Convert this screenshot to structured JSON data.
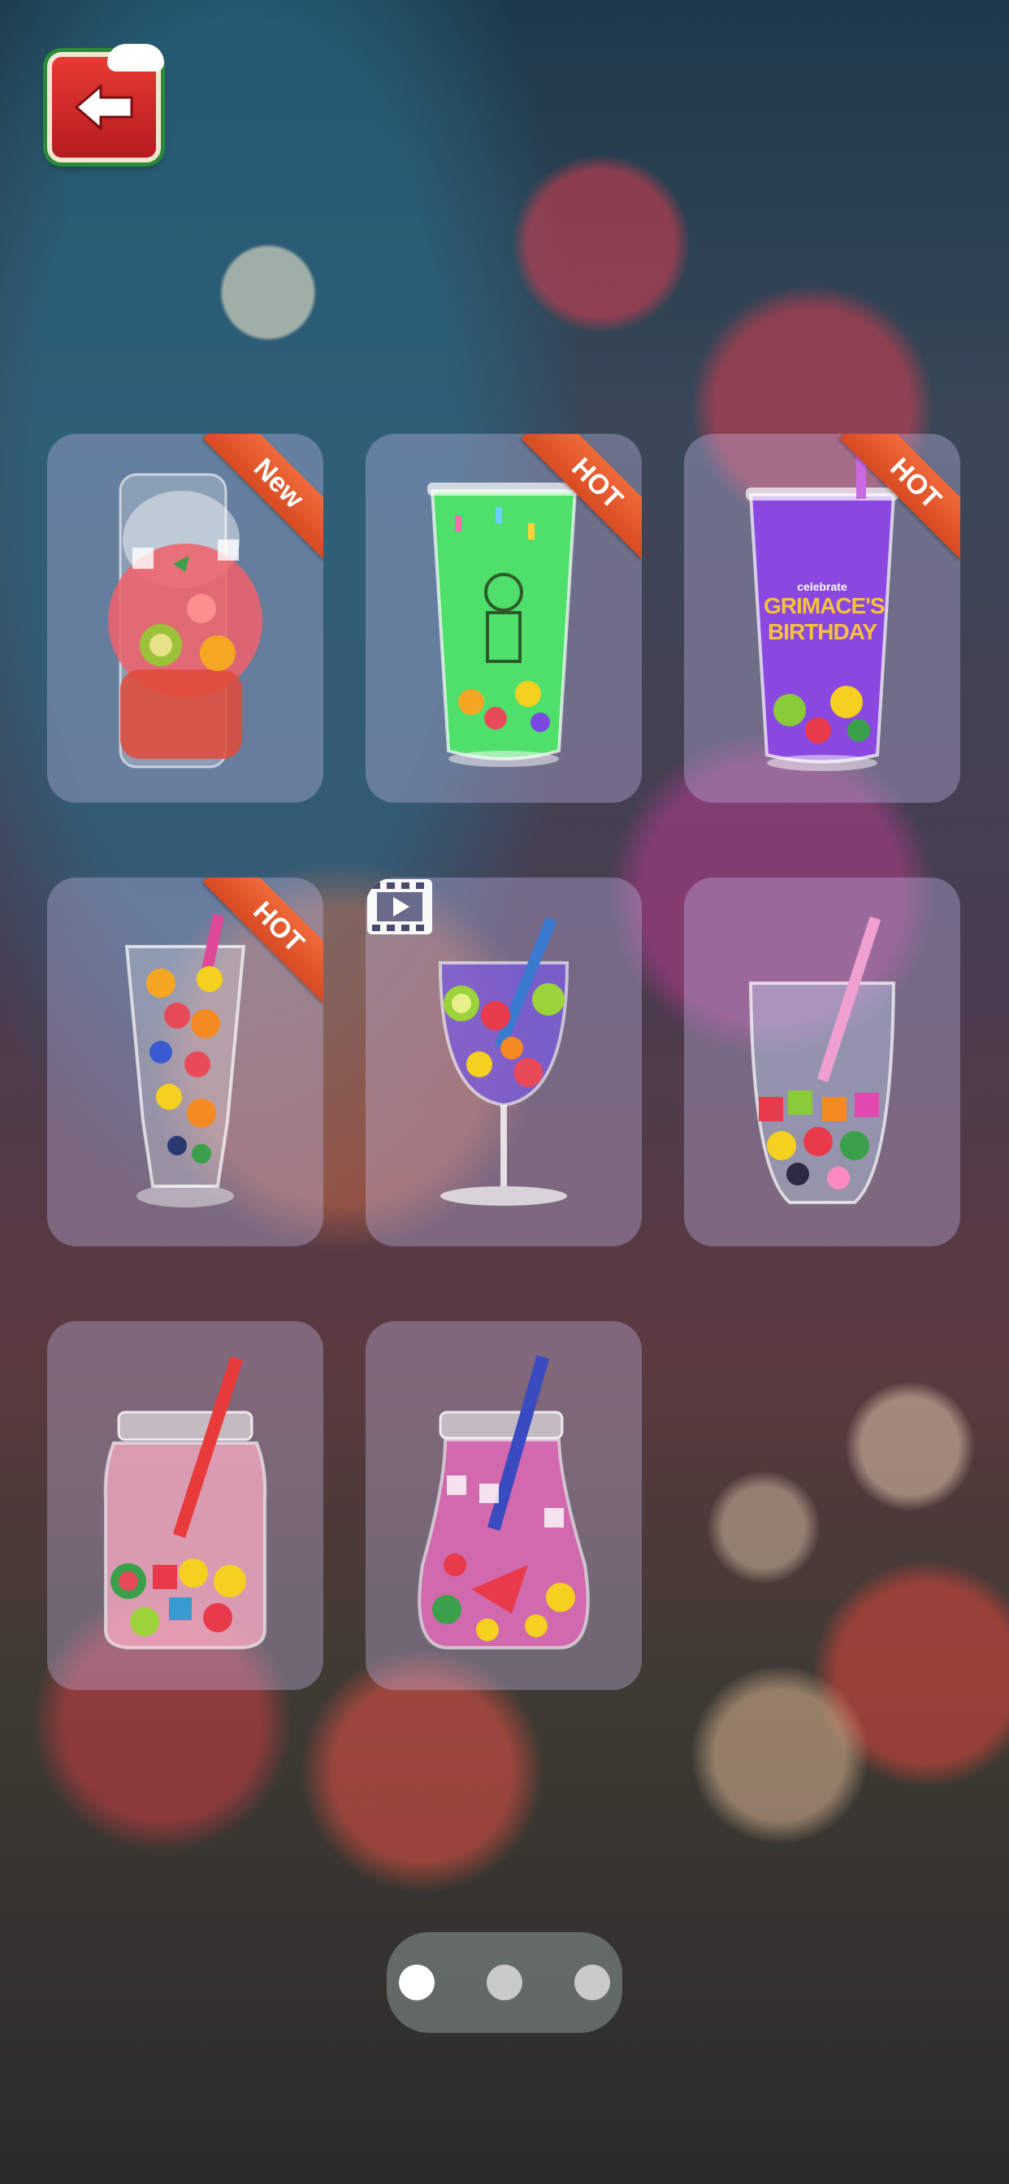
{
  "back_button": {
    "icon": "arrow-left-icon"
  },
  "cards": [
    {
      "name": "santa-cup-drink",
      "badge": "New",
      "locked_by_video": false
    },
    {
      "name": "skeleton-green-cup-drink",
      "badge": "HOT",
      "locked_by_video": false
    },
    {
      "name": "grimace-purple-cup-drink",
      "badge": "HOT",
      "locked_by_video": false,
      "cup_text": [
        "celebrate",
        "GRIMACE'S",
        "BIRTHDAY"
      ]
    },
    {
      "name": "fruit-tall-glass-drink",
      "badge": "HOT",
      "locked_by_video": false
    },
    {
      "name": "wine-glass-fruit-drink",
      "badge": "",
      "locked_by_video": true
    },
    {
      "name": "gummy-bear-glass-drink",
      "badge": "",
      "locked_by_video": false
    },
    {
      "name": "pink-mason-jar-drink",
      "badge": "",
      "locked_by_video": false
    },
    {
      "name": "pink-bottle-fruit-drink",
      "badge": "",
      "locked_by_video": false
    }
  ],
  "pager": {
    "pages": 3,
    "current": 1
  },
  "colors": {
    "ribbon": "#e85a2c",
    "back_button": "#d12a2a",
    "card_bg": "#c8beeb"
  }
}
